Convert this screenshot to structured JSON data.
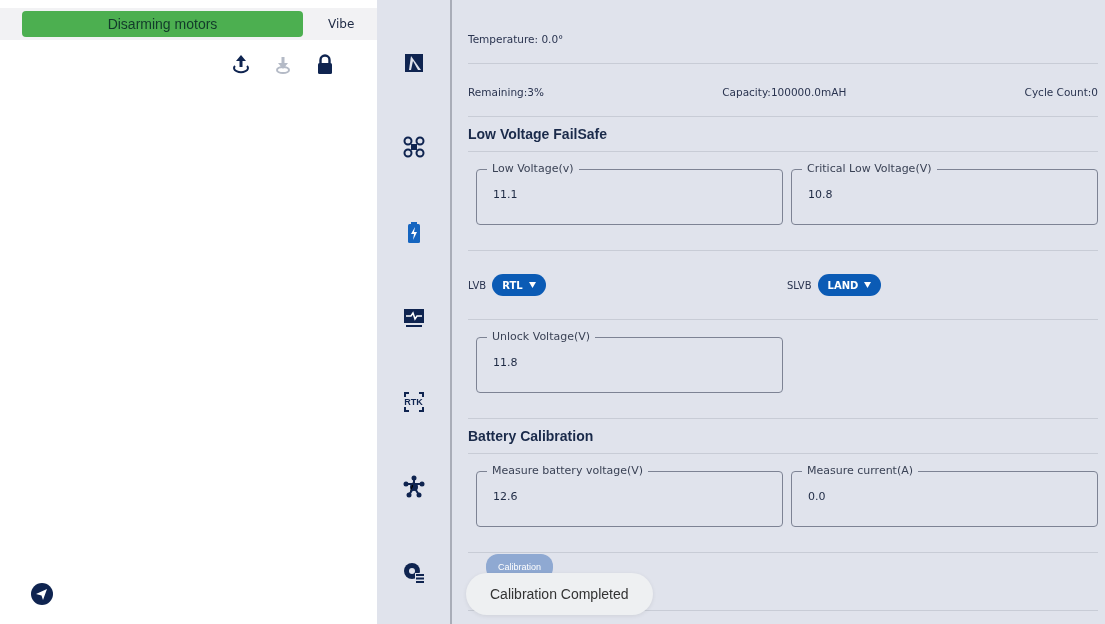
{
  "status_button": {
    "label": "Disarming motors"
  },
  "top_tab": {
    "label": "Vibe"
  },
  "toolbar": [
    {
      "disabled": false
    },
    {
      "disabled": true
    },
    {
      "disabled": false
    }
  ],
  "sidebar": {
    "items": [
      {
        "selected": false
      },
      {
        "selected": false
      },
      {
        "selected": true
      },
      {
        "selected": false
      },
      {
        "selected": false,
        "text": "RTK"
      },
      {
        "selected": false
      },
      {
        "selected": false
      }
    ]
  },
  "blocks": [
    {
      "kind": "info",
      "items": [
        "Temperature: 0.0°"
      ]
    },
    {
      "kind": "info",
      "items": [
        "Remaining:3%",
        "Capacity:100000.0mAH",
        "Cycle Count:0"
      ]
    },
    {
      "kind": "heading",
      "text": "Low Voltage FailSafe"
    },
    {
      "kind": "fields",
      "fields": [
        {
          "label": "Low Voltage(v)",
          "value": "11.1"
        },
        {
          "label": "Critical Low Voltage(V)",
          "value": "10.8"
        }
      ]
    },
    {
      "kind": "selects",
      "selects": [
        {
          "label": "LVB",
          "value": "RTL"
        },
        {
          "label": "SLVB",
          "value": "LAND"
        }
      ]
    },
    {
      "kind": "fields",
      "fields": [
        {
          "label": "Unlock Voltage(V)",
          "value": "11.8"
        }
      ]
    },
    {
      "kind": "heading",
      "text": "Battery Calibration"
    },
    {
      "kind": "fields",
      "fields": [
        {
          "label": "Measure battery voltage(V)",
          "value": "12.6"
        },
        {
          "label": "Measure current(A)",
          "value": "0.0"
        }
      ]
    },
    {
      "kind": "button",
      "label": "Calibration"
    }
  ],
  "toast": {
    "text": "Calibration Completed"
  }
}
